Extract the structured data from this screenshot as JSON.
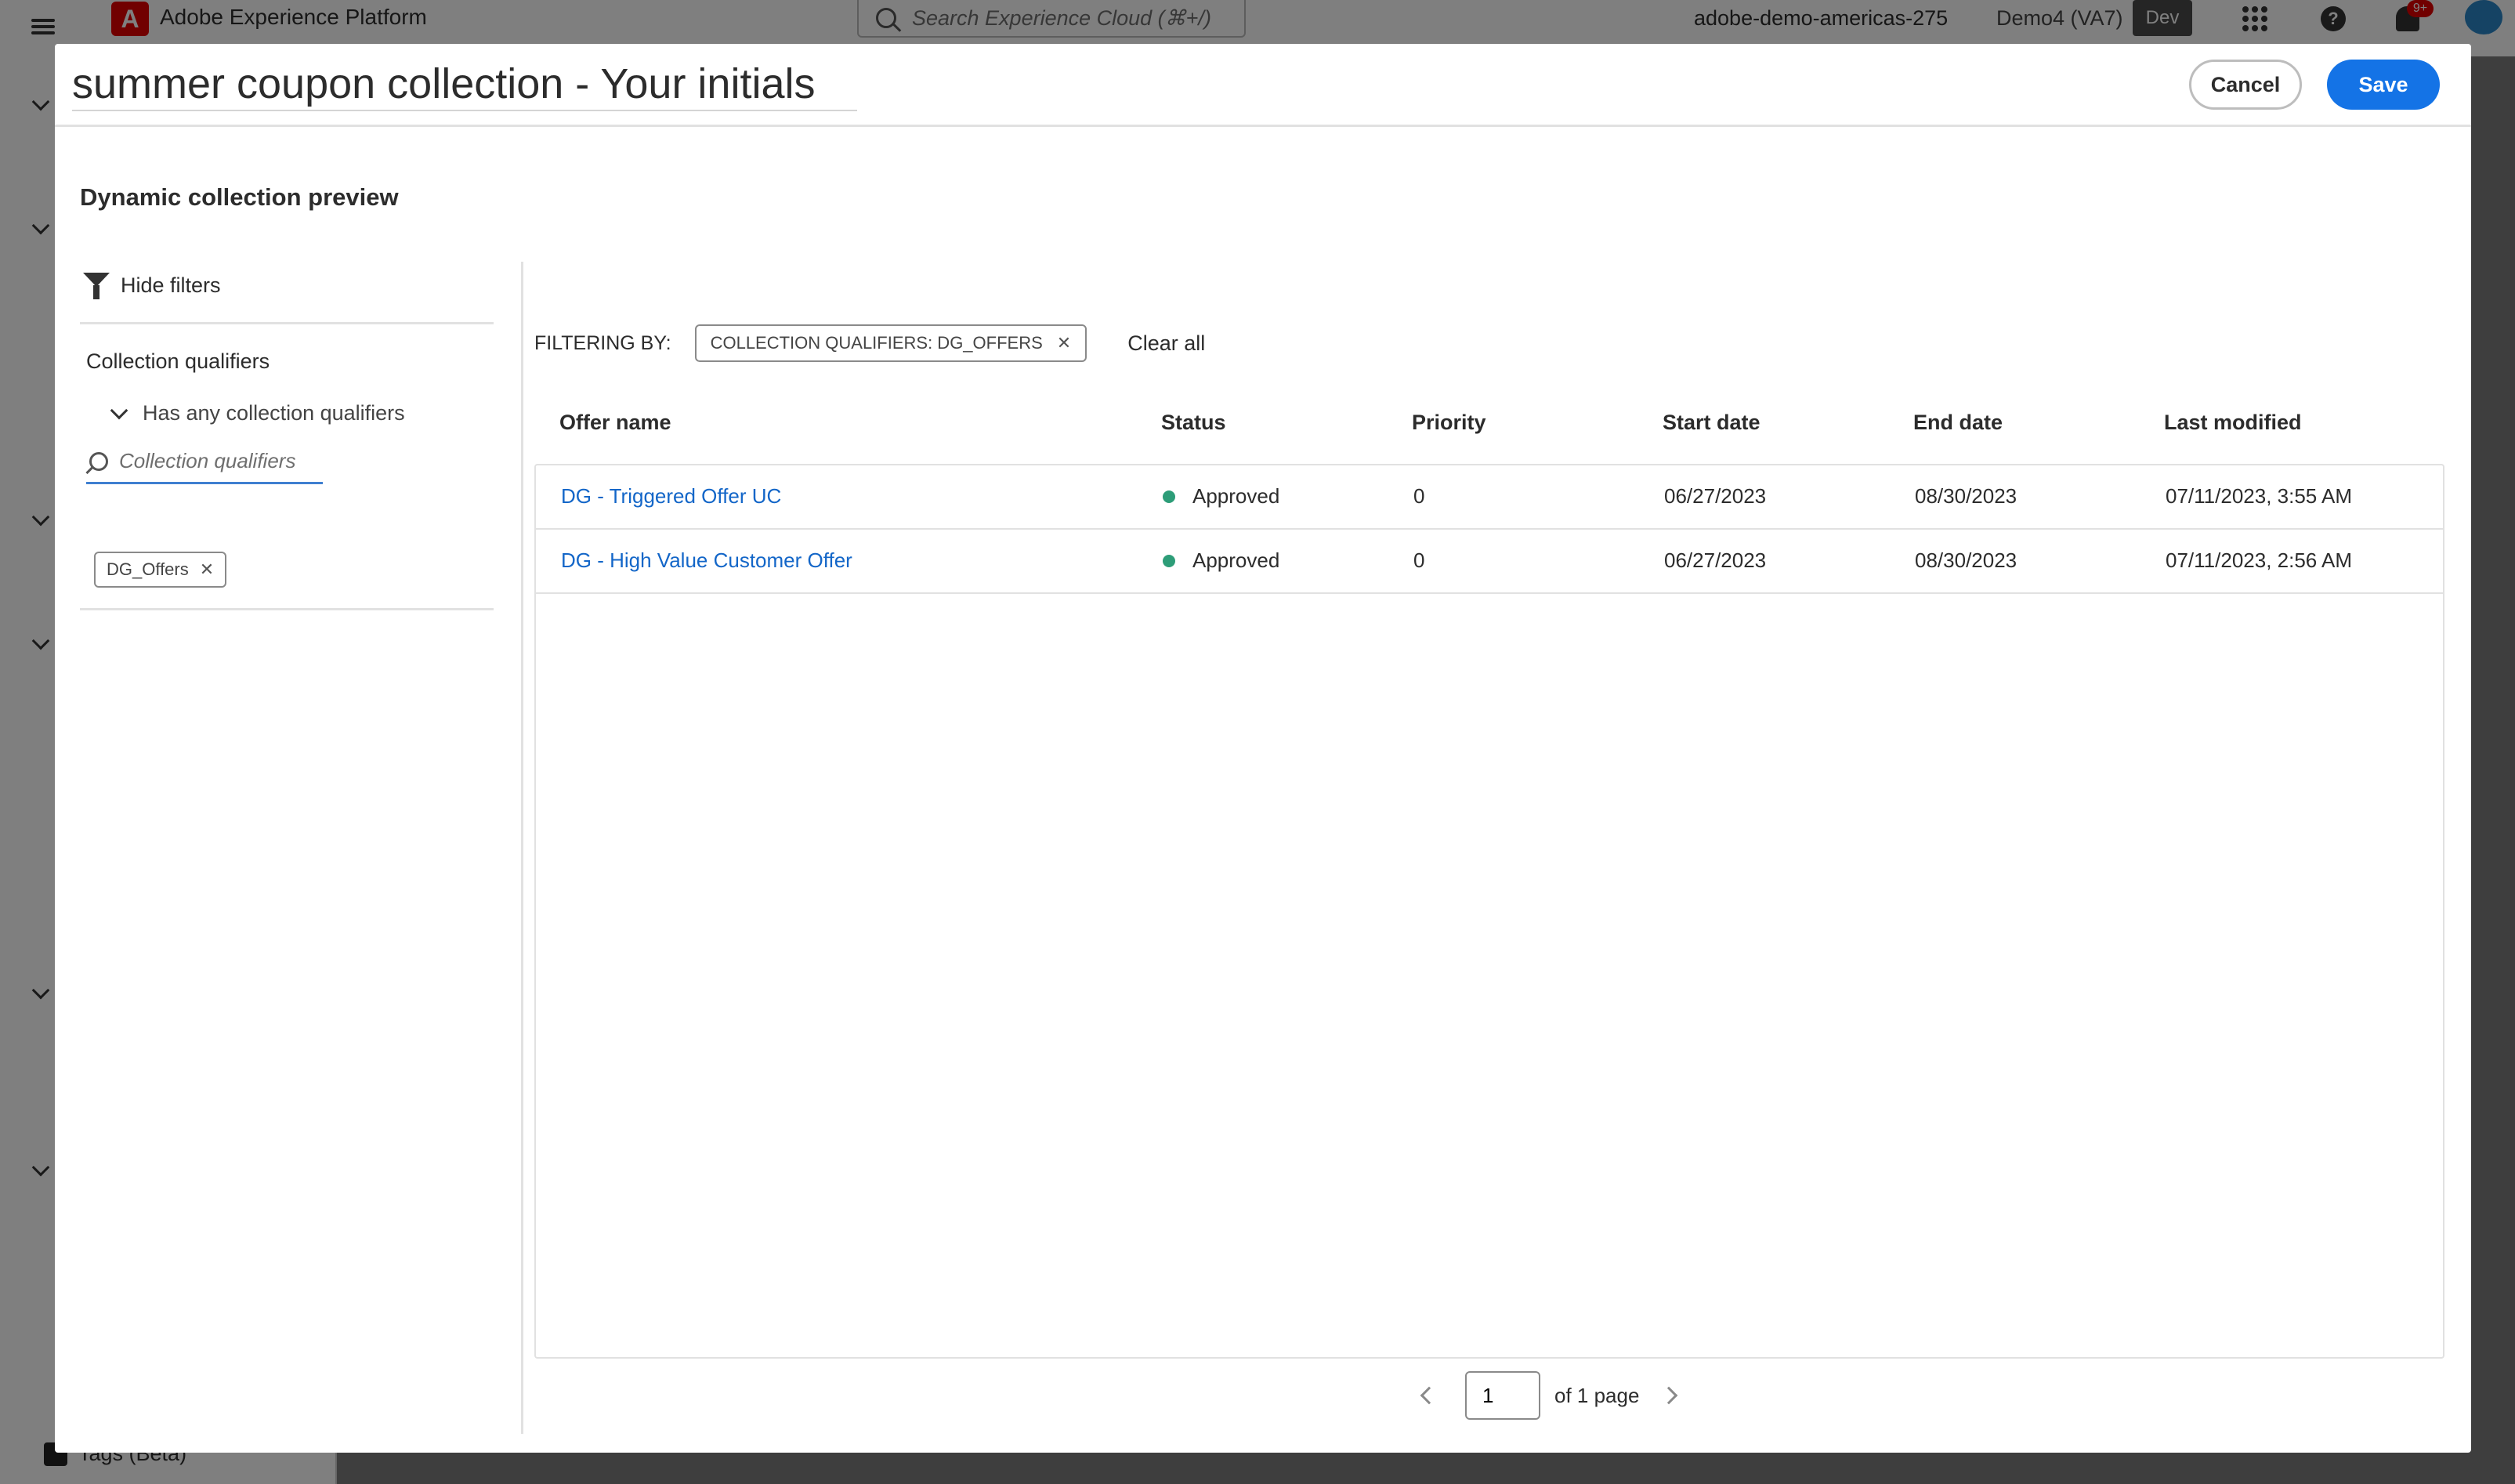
{
  "topbar": {
    "app_title": "Adobe Experience Platform",
    "search_placeholder": "Search Experience Cloud (⌘+/)",
    "org": "adobe-demo-americas-275",
    "sandbox": "Demo4 (VA7)",
    "env_badge": "Dev",
    "notification_count": "9+"
  },
  "leftnav": {
    "tags_label": "Tags (Beta)"
  },
  "modal": {
    "title": "summer coupon collection - Your initials",
    "cancel_label": "Cancel",
    "save_label": "Save",
    "section_title": "Dynamic collection preview"
  },
  "filters": {
    "hide_filters_label": "Hide filters",
    "qualifiers_title": "Collection qualifiers",
    "has_any_label": "Has any collection qualifiers",
    "search_placeholder": "Collection qualifiers",
    "selected_chip": "DG_Offers"
  },
  "filter_bar": {
    "label": "FILTERING BY:",
    "pill": "COLLECTION QUALIFIERS: DG_OFFERS",
    "clear_all": "Clear all"
  },
  "table": {
    "columns": [
      "Offer name",
      "Status",
      "Priority",
      "Start date",
      "End date",
      "Last modified"
    ],
    "rows": [
      {
        "name": "DG - Triggered Offer UC",
        "status": "Approved",
        "priority": "0",
        "start": "06/27/2023",
        "end": "08/30/2023",
        "modified": "07/11/2023, 3:55 AM"
      },
      {
        "name": "DG - High Value Customer Offer",
        "status": "Approved",
        "priority": "0",
        "start": "06/27/2023",
        "end": "08/30/2023",
        "modified": "07/11/2023, 2:56 AM"
      }
    ],
    "status_color": "#2d9d78"
  },
  "pager": {
    "current_page": "1",
    "of_label": "of 1 page"
  }
}
